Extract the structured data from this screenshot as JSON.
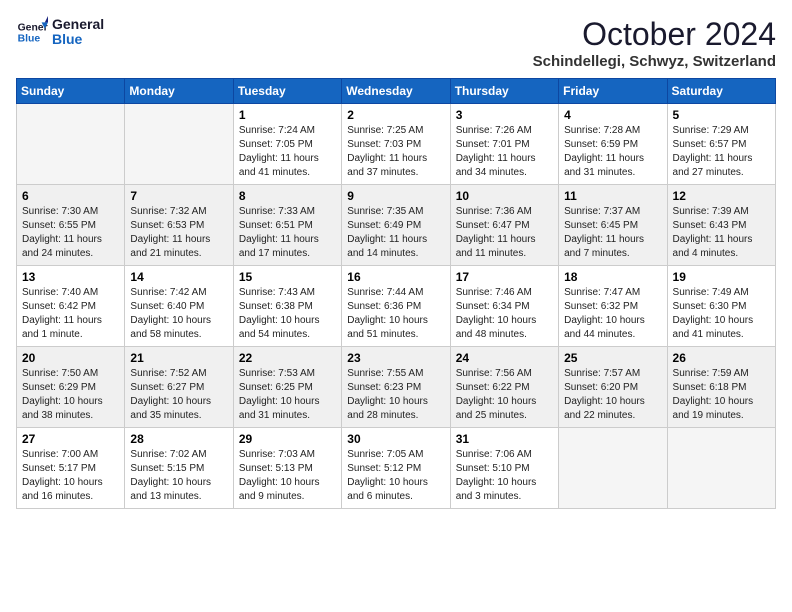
{
  "header": {
    "logo_line1": "General",
    "logo_line2": "Blue",
    "month_title": "October 2024",
    "location": "Schindellegi, Schwyz, Switzerland"
  },
  "days_of_week": [
    "Sunday",
    "Monday",
    "Tuesday",
    "Wednesday",
    "Thursday",
    "Friday",
    "Saturday"
  ],
  "weeks": [
    [
      {
        "day": "",
        "info": ""
      },
      {
        "day": "",
        "info": ""
      },
      {
        "day": "1",
        "info": "Sunrise: 7:24 AM\nSunset: 7:05 PM\nDaylight: 11 hours and 41 minutes."
      },
      {
        "day": "2",
        "info": "Sunrise: 7:25 AM\nSunset: 7:03 PM\nDaylight: 11 hours and 37 minutes."
      },
      {
        "day": "3",
        "info": "Sunrise: 7:26 AM\nSunset: 7:01 PM\nDaylight: 11 hours and 34 minutes."
      },
      {
        "day": "4",
        "info": "Sunrise: 7:28 AM\nSunset: 6:59 PM\nDaylight: 11 hours and 31 minutes."
      },
      {
        "day": "5",
        "info": "Sunrise: 7:29 AM\nSunset: 6:57 PM\nDaylight: 11 hours and 27 minutes."
      }
    ],
    [
      {
        "day": "6",
        "info": "Sunrise: 7:30 AM\nSunset: 6:55 PM\nDaylight: 11 hours and 24 minutes."
      },
      {
        "day": "7",
        "info": "Sunrise: 7:32 AM\nSunset: 6:53 PM\nDaylight: 11 hours and 21 minutes."
      },
      {
        "day": "8",
        "info": "Sunrise: 7:33 AM\nSunset: 6:51 PM\nDaylight: 11 hours and 17 minutes."
      },
      {
        "day": "9",
        "info": "Sunrise: 7:35 AM\nSunset: 6:49 PM\nDaylight: 11 hours and 14 minutes."
      },
      {
        "day": "10",
        "info": "Sunrise: 7:36 AM\nSunset: 6:47 PM\nDaylight: 11 hours and 11 minutes."
      },
      {
        "day": "11",
        "info": "Sunrise: 7:37 AM\nSunset: 6:45 PM\nDaylight: 11 hours and 7 minutes."
      },
      {
        "day": "12",
        "info": "Sunrise: 7:39 AM\nSunset: 6:43 PM\nDaylight: 11 hours and 4 minutes."
      }
    ],
    [
      {
        "day": "13",
        "info": "Sunrise: 7:40 AM\nSunset: 6:42 PM\nDaylight: 11 hours and 1 minute."
      },
      {
        "day": "14",
        "info": "Sunrise: 7:42 AM\nSunset: 6:40 PM\nDaylight: 10 hours and 58 minutes."
      },
      {
        "day": "15",
        "info": "Sunrise: 7:43 AM\nSunset: 6:38 PM\nDaylight: 10 hours and 54 minutes."
      },
      {
        "day": "16",
        "info": "Sunrise: 7:44 AM\nSunset: 6:36 PM\nDaylight: 10 hours and 51 minutes."
      },
      {
        "day": "17",
        "info": "Sunrise: 7:46 AM\nSunset: 6:34 PM\nDaylight: 10 hours and 48 minutes."
      },
      {
        "day": "18",
        "info": "Sunrise: 7:47 AM\nSunset: 6:32 PM\nDaylight: 10 hours and 44 minutes."
      },
      {
        "day": "19",
        "info": "Sunrise: 7:49 AM\nSunset: 6:30 PM\nDaylight: 10 hours and 41 minutes."
      }
    ],
    [
      {
        "day": "20",
        "info": "Sunrise: 7:50 AM\nSunset: 6:29 PM\nDaylight: 10 hours and 38 minutes."
      },
      {
        "day": "21",
        "info": "Sunrise: 7:52 AM\nSunset: 6:27 PM\nDaylight: 10 hours and 35 minutes."
      },
      {
        "day": "22",
        "info": "Sunrise: 7:53 AM\nSunset: 6:25 PM\nDaylight: 10 hours and 31 minutes."
      },
      {
        "day": "23",
        "info": "Sunrise: 7:55 AM\nSunset: 6:23 PM\nDaylight: 10 hours and 28 minutes."
      },
      {
        "day": "24",
        "info": "Sunrise: 7:56 AM\nSunset: 6:22 PM\nDaylight: 10 hours and 25 minutes."
      },
      {
        "day": "25",
        "info": "Sunrise: 7:57 AM\nSunset: 6:20 PM\nDaylight: 10 hours and 22 minutes."
      },
      {
        "day": "26",
        "info": "Sunrise: 7:59 AM\nSunset: 6:18 PM\nDaylight: 10 hours and 19 minutes."
      }
    ],
    [
      {
        "day": "27",
        "info": "Sunrise: 7:00 AM\nSunset: 5:17 PM\nDaylight: 10 hours and 16 minutes."
      },
      {
        "day": "28",
        "info": "Sunrise: 7:02 AM\nSunset: 5:15 PM\nDaylight: 10 hours and 13 minutes."
      },
      {
        "day": "29",
        "info": "Sunrise: 7:03 AM\nSunset: 5:13 PM\nDaylight: 10 hours and 9 minutes."
      },
      {
        "day": "30",
        "info": "Sunrise: 7:05 AM\nSunset: 5:12 PM\nDaylight: 10 hours and 6 minutes."
      },
      {
        "day": "31",
        "info": "Sunrise: 7:06 AM\nSunset: 5:10 PM\nDaylight: 10 hours and 3 minutes."
      },
      {
        "day": "",
        "info": ""
      },
      {
        "day": "",
        "info": ""
      }
    ]
  ]
}
